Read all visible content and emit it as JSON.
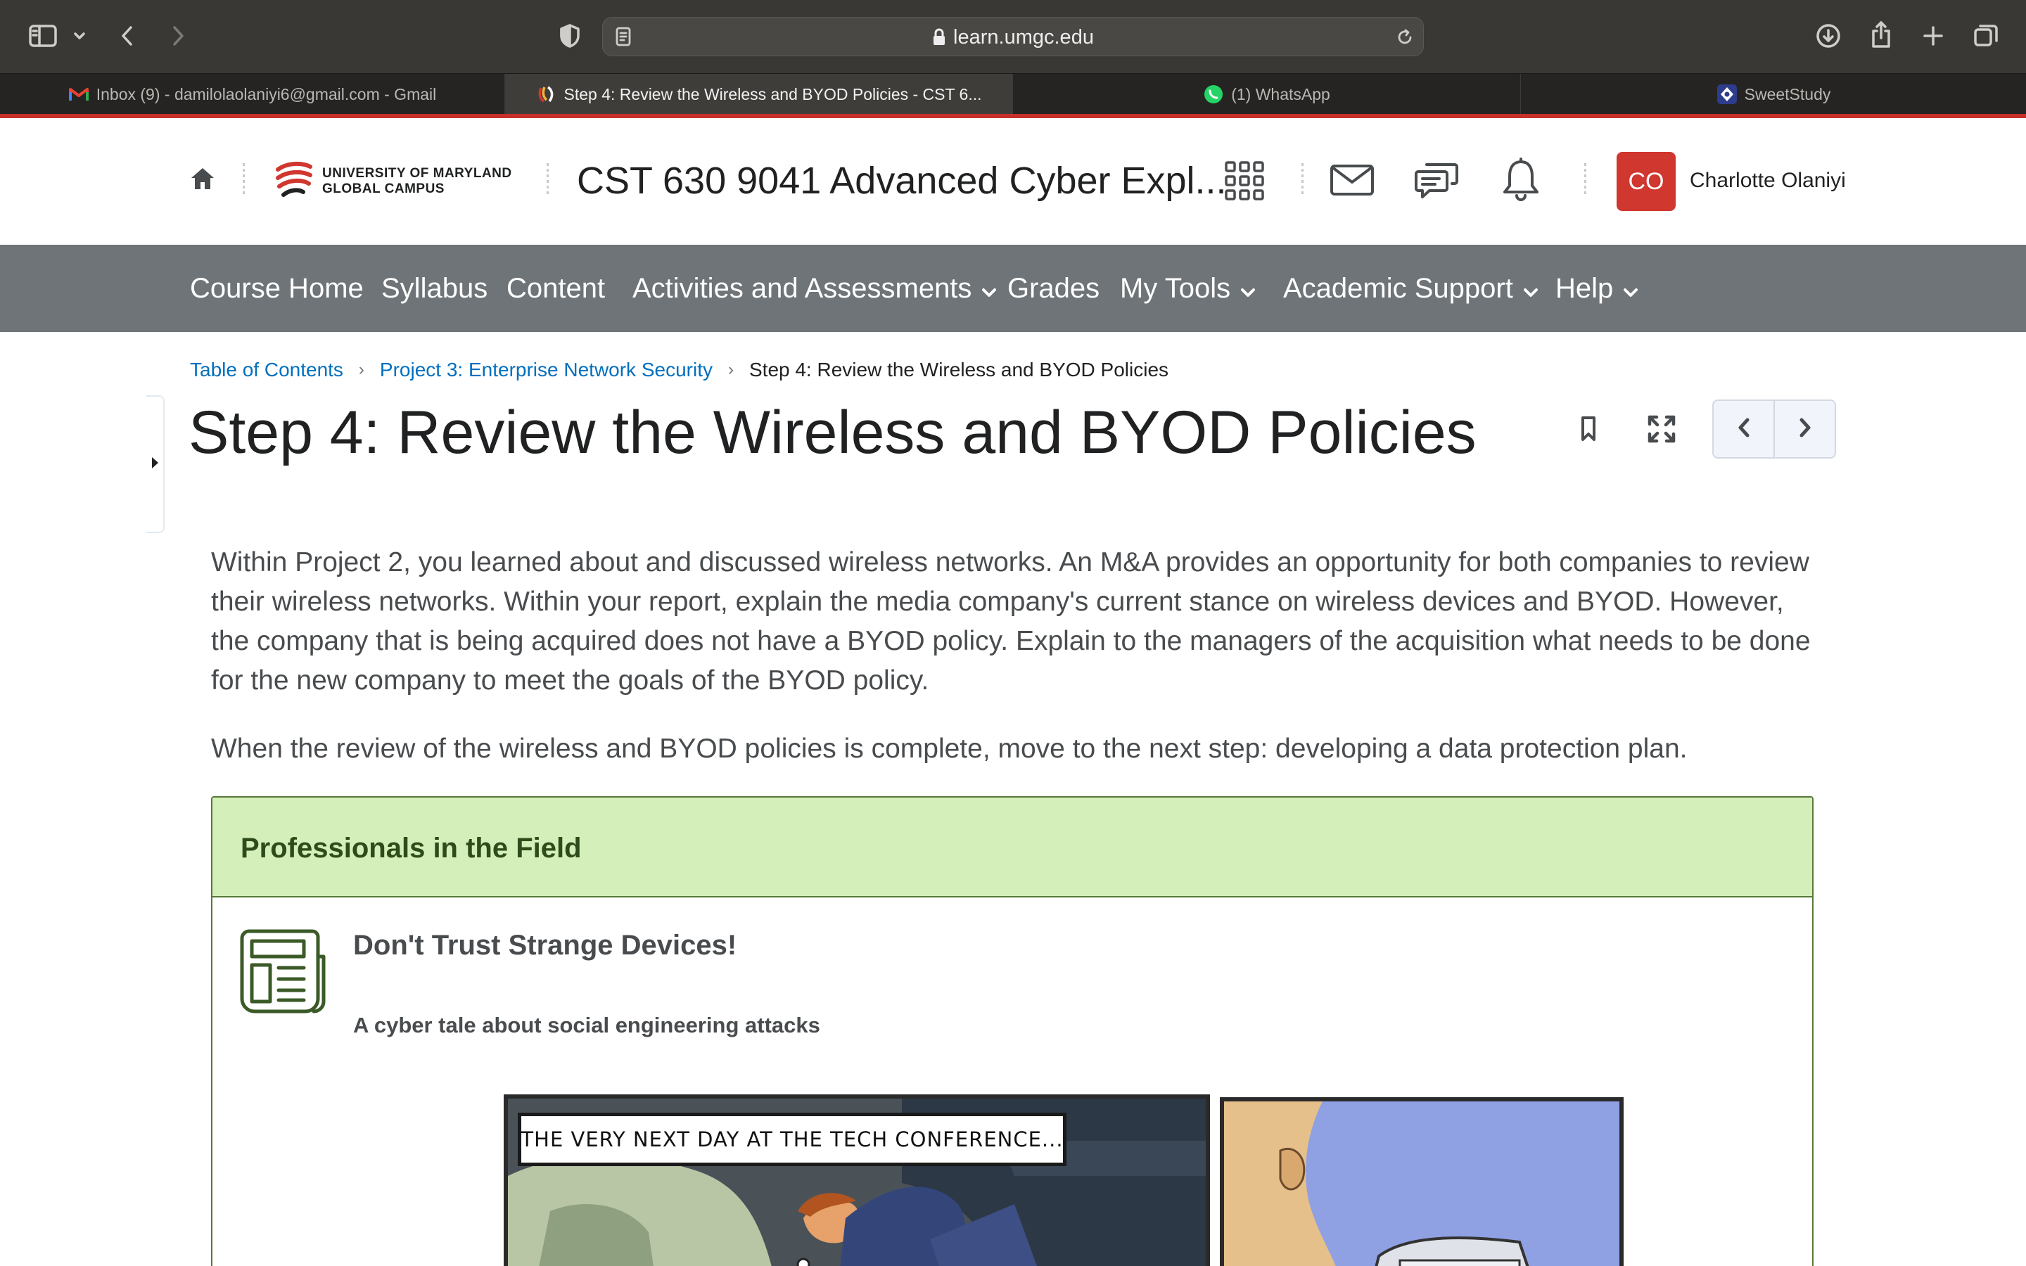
{
  "browser": {
    "url": "learn.umgc.edu",
    "tabs": [
      {
        "label": "Inbox (9) - damilolaolaniyi6@gmail.com - Gmail",
        "active": false,
        "icon": "gmail-icon"
      },
      {
        "label": "Step 4: Review the Wireless and BYOD Policies - CST 6...",
        "active": true,
        "icon": "umgc-icon"
      },
      {
        "label": "(1) WhatsApp",
        "active": false,
        "icon": "whatsapp-icon"
      },
      {
        "label": "SweetStudy",
        "active": false,
        "icon": "sweetstudy-icon"
      }
    ]
  },
  "header": {
    "logo_line1": "UNIVERSITY OF MARYLAND",
    "logo_line2": "GLOBAL CAMPUS",
    "course_title": "CST 630 9041 Advanced Cyber Expl...",
    "user_initials": "CO",
    "user_name": "Charlotte Olaniyi",
    "avatar_color": "#d0372f"
  },
  "nav": {
    "items": [
      {
        "label": "Course Home",
        "dropdown": false
      },
      {
        "label": "Syllabus",
        "dropdown": false
      },
      {
        "label": "Content",
        "dropdown": false
      },
      {
        "label": "Activities and Assessments",
        "dropdown": true
      },
      {
        "label": "Grades",
        "dropdown": false
      },
      {
        "label": "My Tools",
        "dropdown": true
      },
      {
        "label": "Academic Support",
        "dropdown": true
      },
      {
        "label": "Help",
        "dropdown": true
      }
    ]
  },
  "breadcrumb": {
    "items": [
      "Table of Contents",
      "Project 3: Enterprise Network Security"
    ],
    "current": "Step 4: Review the Wireless and BYOD Policies"
  },
  "page": {
    "title": "Step 4: Review the Wireless and BYOD Policies",
    "paragraphs": [
      "Within Project 2, you learned about and discussed wireless networks. An M&A provides an opportunity for both companies to review their wireless networks. Within your report, explain the media company's current stance on wireless devices and BYOD. However, the company that is being acquired does not have a BYOD policy. Explain to the managers of the acquisition what needs to be done for the new company to meet the goals of the BYOD policy.",
      "When the review of the wireless and BYOD policies is complete, move to the next step: developing a data protection plan."
    ]
  },
  "callout": {
    "heading": "Professionals in the Field",
    "item_title": "Don't Trust Strange Devices!",
    "item_subtitle": "A cyber tale about social engineering attacks",
    "comic_caption": "THE VERY NEXT DAY AT THE TECH CONFERENCE..."
  },
  "colors": {
    "brand_red": "#c8302b",
    "nav_bg": "#6e7477",
    "link": "#006fbf",
    "callout_bg": "#d4efb9",
    "callout_border": "#58783a"
  }
}
